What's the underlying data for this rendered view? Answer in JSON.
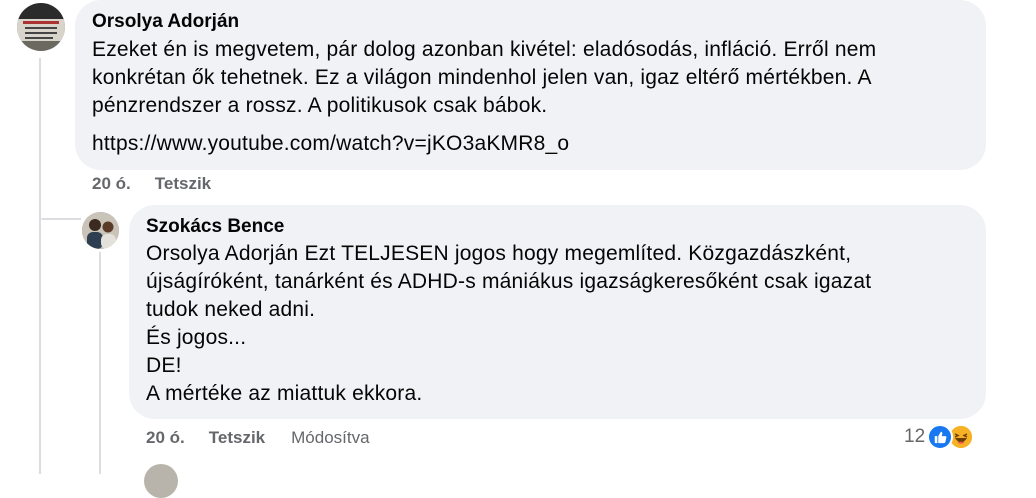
{
  "comments": [
    {
      "author": "Orsolya Adorján",
      "lines": [
        "Ezeket én is megvetem, pár dolog azonban kivétel: eladósodás, infláció. Erről nem",
        "konkrétan ők tehetnek. Ez a világon mindenhol jelen van, igaz eltérő mértékben. A",
        "pénzrendszer a rossz. A politikusok csak bábok."
      ],
      "link": "https://www.youtube.com/watch?v=jKO3aKMR8_o",
      "time": "20 ó.",
      "like_label": "Tetszik"
    },
    {
      "author": "Szokács Bence",
      "lines": [
        "Orsolya Adorján Ezt TELJESEN jogos hogy megemlíted. Közgazdászként,",
        "újságíróként, tanárként és ADHD-s mániákus igazságkeresőként csak igazat",
        "tudok neked adni.",
        "És jogos...",
        "DE!",
        "A mértéke az miattuk ekkora."
      ],
      "time": "20 ó.",
      "like_label": "Tetszik",
      "edited_label": "Módosítva",
      "reaction_count": "12",
      "reaction_icons": [
        "like-icon",
        "laugh-icon"
      ],
      "colors": {
        "like": "#1877f2",
        "laugh": "#f7b125"
      }
    }
  ]
}
